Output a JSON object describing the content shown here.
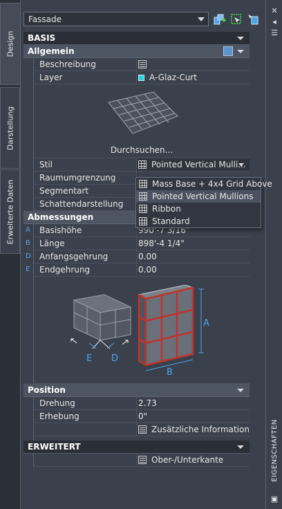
{
  "tabs": [
    "Design",
    "Darstellung",
    "Erweiterte Daten"
  ],
  "style_selector": {
    "value": "Fassade"
  },
  "sections": {
    "basis": {
      "title": "BASIS"
    },
    "allgemein": {
      "title": "Allgemein",
      "rows": [
        {
          "label": "Beschreibung",
          "value": "",
          "icon": "document-icon"
        },
        {
          "label": "Layer",
          "value": "A-Glaz-Curt",
          "icon": "layer-color-icon",
          "color": "#2ecfe0"
        }
      ],
      "browse": "Durchsuchen...",
      "stil": {
        "label": "Stil",
        "value": "Pointed Vertical Mulli..."
      },
      "more_rows": [
        {
          "label": "Raumumgrenzung"
        },
        {
          "label": "Segmentart"
        },
        {
          "label": "Schattendarstellung"
        }
      ]
    },
    "abmessungen": {
      "title": "Abmessungen",
      "rows": [
        {
          "mark": "A",
          "label": "Basishöhe",
          "value": "990'-7 3/16\""
        },
        {
          "mark": "B",
          "label": "Länge",
          "value": "898'-4 1/4\""
        },
        {
          "mark": "D",
          "label": "Anfangsgehrung",
          "value": "0.00"
        },
        {
          "mark": "E",
          "label": "Endgehrung",
          "value": "0.00"
        }
      ],
      "diagram_labels": {
        "a": "A",
        "b": "B",
        "d": "D",
        "e": "E"
      }
    },
    "position": {
      "title": "Position",
      "rows": [
        {
          "label": "Drehung",
          "value": "2.73"
        },
        {
          "label": "Erhebung",
          "value": "0\""
        }
      ],
      "extra": "Zusätzliche Informationen"
    },
    "erweitert": {
      "title": "ERWEITERT",
      "extra": "Ober-/Unterkante"
    }
  },
  "dropdown": {
    "options": [
      "Mass Base + 4x4 Grid Above",
      "Pointed Vertical Mullions",
      "Ribbon",
      "Standard"
    ],
    "selected_index": 1
  },
  "palette_title": "EIGENSCHAFTEN",
  "colors": {
    "accent": "#5aa0e6",
    "layer": "#2ecfe0",
    "background": "#3b414c"
  }
}
